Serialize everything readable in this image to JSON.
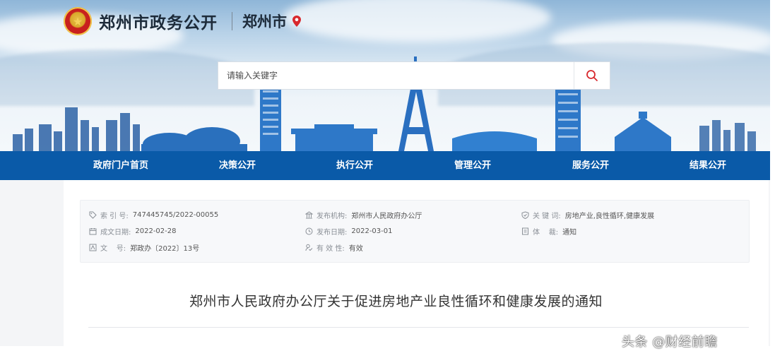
{
  "header": {
    "site_title": "郑州市政务公开",
    "city": "郑州市",
    "emblem_icon": "national-emblem-icon",
    "location_icon": "location-pin-icon"
  },
  "search": {
    "placeholder": "请输入关键字",
    "icon": "search-icon"
  },
  "nav": {
    "items": [
      {
        "label": "政府门户首页"
      },
      {
        "label": "决策公开"
      },
      {
        "label": "执行公开"
      },
      {
        "label": "管理公开"
      },
      {
        "label": "服务公开"
      },
      {
        "label": "结果公开"
      }
    ]
  },
  "meta": {
    "index_no": {
      "label": "索 引 号:",
      "value": "747445745/2022-00055",
      "icon": "tag-icon"
    },
    "issuer": {
      "label": "发布机构:",
      "value": "郑州市人民政府办公厅",
      "icon": "building-icon"
    },
    "keywords": {
      "label": "关 键 词:",
      "value": "房地产业,良性循环,健康发展",
      "icon": "shield-icon"
    },
    "created_date": {
      "label": "成文日期:",
      "value": "2022-02-28",
      "icon": "calendar-icon"
    },
    "publish_date": {
      "label": "发布日期:",
      "value": "2022-03-01",
      "icon": "clock-icon"
    },
    "genre": {
      "label": "体    裁:",
      "value": "通知",
      "icon": "document-icon"
    },
    "doc_no": {
      "label": "文    号:",
      "value": "郑政办〔2022〕13号",
      "icon": "file-number-icon"
    },
    "validity": {
      "label": "有 效 性:",
      "value": "有效",
      "icon": "validity-icon"
    }
  },
  "document": {
    "title": "郑州市人民政府办公厅关于促进房地产业良性循环和健康发展的通知"
  },
  "watermark": {
    "text": "头条 @财经前瞻"
  },
  "colors": {
    "nav_bg": "#0a5aa8",
    "accent_red": "#d8282d",
    "title_text": "#1d2b3a"
  }
}
